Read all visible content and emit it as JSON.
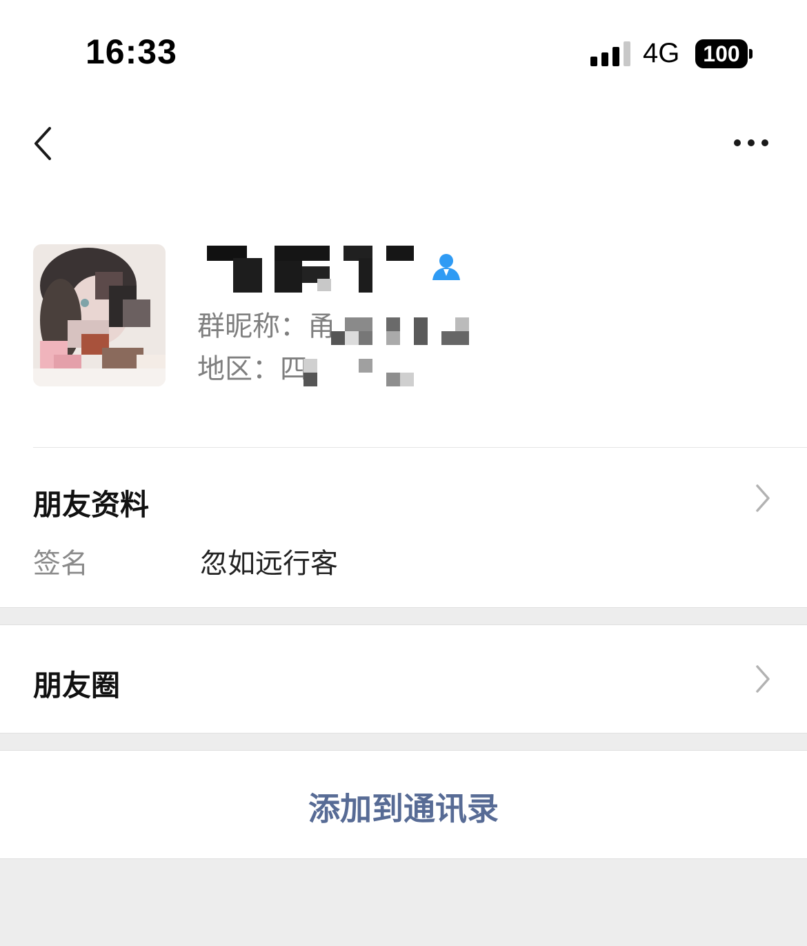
{
  "status_bar": {
    "time": "16:33",
    "network": "4G",
    "battery": "100"
  },
  "nav": {
    "back_icon": "chevron-left-icon",
    "more_icon": "more-horizontal-icon"
  },
  "profile": {
    "group_nickname_label": "群昵称：",
    "group_nickname_visible": "甬",
    "region_label": "地区：",
    "region_visible": "四",
    "contact_icon": "person-icon",
    "contact_icon_color": "#2f9bf4"
  },
  "friend_info": {
    "title": "朋友资料",
    "signature_label": "签名",
    "signature_value": "忽如远行客"
  },
  "moments": {
    "title": "朋友圈"
  },
  "add_button": {
    "label": "添加到通讯录",
    "color": "#576b95"
  },
  "colors": {
    "background": "#ffffff",
    "separator": "#ededed",
    "secondary_text": "#7f7f7f"
  }
}
